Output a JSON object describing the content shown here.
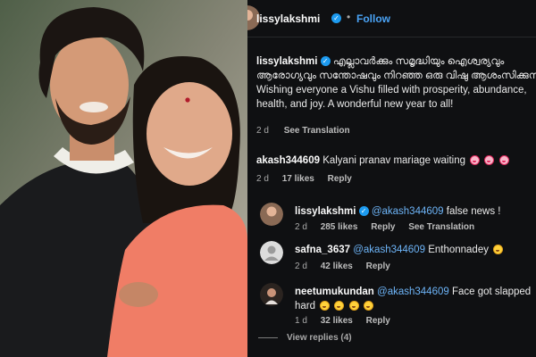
{
  "post": {
    "username": "lissylakshmi",
    "follow_label": "Follow",
    "separator": "•",
    "caption_text": "എല്ലാവർക്കും സമൃദ്ധിയും ഐശ്വര്യവും ആരോഗ്യവും സന്തോഷവും നിറഞ്ഞ ഒരു വിഷു ആശംസിക്കുന്നു! Wishing everyone a Vishu filled with prosperity, abundance, health, and joy. A wonderful new year to all!",
    "age": "2 d",
    "see_translation": "See Translation"
  },
  "comment": {
    "username": "akash344609",
    "text": "Kalyani pranav mariage waiting",
    "age": "2 d",
    "likes": "17 likes",
    "reply_label": "Reply"
  },
  "replies": [
    {
      "username": "lissylakshmi",
      "mention": "@akash344609",
      "text": "false news !",
      "age": "2 d",
      "likes": "285 likes",
      "reply_label": "Reply",
      "see_translation": "See Translation"
    },
    {
      "username": "safna_3637",
      "mention": "@akash344609",
      "text": "Enthonnadey",
      "age": "2 d",
      "likes": "42 likes",
      "reply_label": "Reply"
    },
    {
      "username": "neetumukundan",
      "mention": "@akash344609",
      "text": "Face got slapped hard",
      "age": "1 d",
      "likes": "32 likes",
      "reply_label": "Reply"
    }
  ],
  "view_replies": "View replies (4)",
  "icons": {
    "verified": "verified-badge-icon",
    "heart_eyes": "smiling-face-with-heart-eyes-emoji",
    "laughing": "grinning-squinting-face-emoji"
  },
  "colors": {
    "background": "#0f1012",
    "link_blue": "#4aa3f5",
    "mention_blue": "#6db4f7",
    "verified_blue": "#1d9bf0",
    "muted": "#a8a8a8"
  }
}
